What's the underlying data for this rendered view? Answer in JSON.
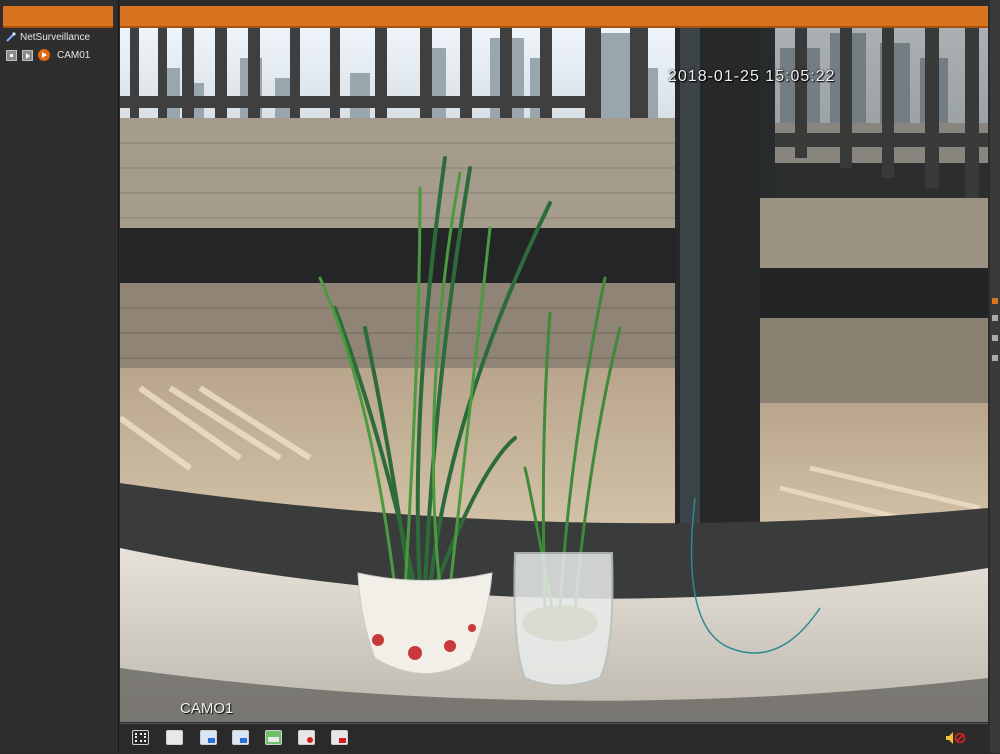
{
  "sidebar": {
    "root_label": "NetSurveillance",
    "camera_label": "CAM01"
  },
  "video": {
    "timestamp": "2018-01-25 15:05:22",
    "camera_overlay": "CAMO1"
  },
  "toolbar": {
    "icons": [
      "fullscreen-icon",
      "single-view-icon",
      "monitor-icon",
      "monitor-icon",
      "snapshot-icon",
      "record-icon",
      "mute-record-icon",
      "volume-mute-icon"
    ]
  },
  "colors": {
    "header_orange": "#d8741f",
    "panel_dark": "#2e2e2e",
    "accent_play": "#e06a12"
  }
}
